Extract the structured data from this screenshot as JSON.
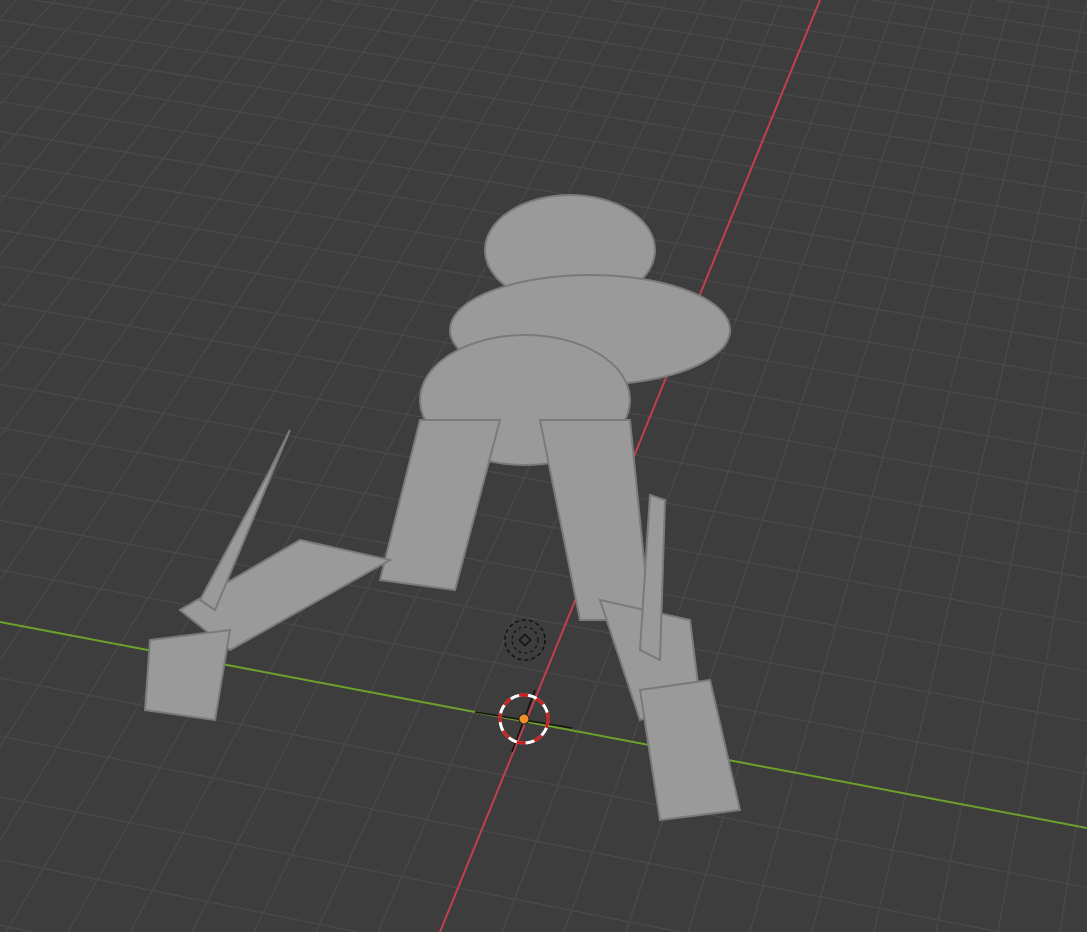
{
  "viewport": {
    "view": "3D Viewport",
    "colors": {
      "background": "#3d3d3d",
      "grid": "#4a4a4a",
      "x_axis": "#c0404c",
      "y_axis": "#6ea12a",
      "mesh": "#9a9a9a",
      "mesh_shadow": "#7a7a7a",
      "origin": "#f0902a",
      "cursor_red": "#d02020",
      "cursor_white": "#ffffff"
    }
  }
}
